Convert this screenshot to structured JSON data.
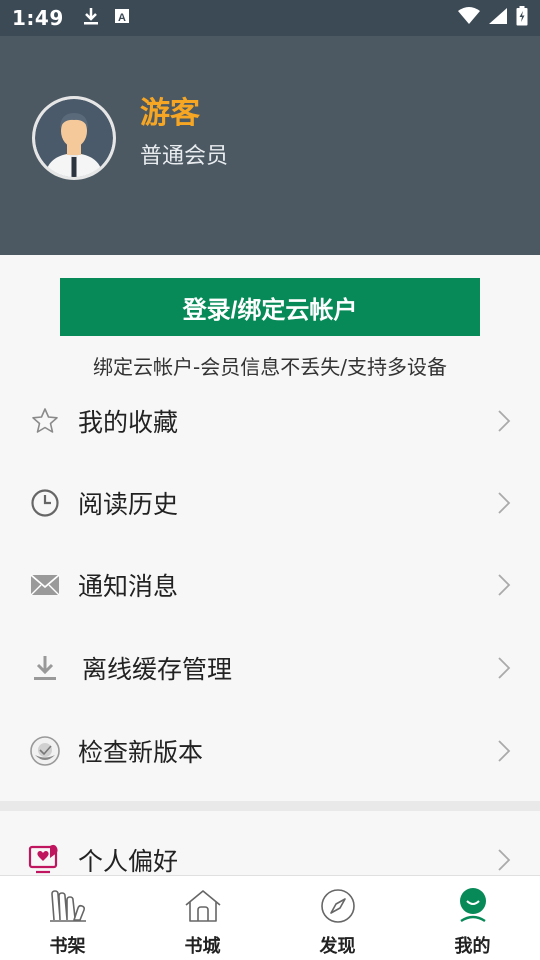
{
  "status_bar": {
    "time": "1:49",
    "icons": [
      "download-icon",
      "font-icon",
      "wifi-icon",
      "signal-icon",
      "battery-charging-icon"
    ]
  },
  "profile": {
    "name": "游客",
    "level": "普通会员",
    "avatar_icon": "user-avatar-icon",
    "name_color": "#f6a623"
  },
  "login": {
    "button_label": "登录/绑定云帐户",
    "hint": "绑定云帐户-会员信息不丢失/支持多设备",
    "button_color": "#078a58"
  },
  "menu": {
    "items": [
      {
        "label": "我的收藏",
        "icon": "star-icon"
      },
      {
        "label": "阅读历史",
        "icon": "clock-icon"
      },
      {
        "label": "通知消息",
        "icon": "mail-icon"
      },
      {
        "label": "离线缓存管理",
        "icon": "download-icon"
      },
      {
        "label": "检查新版本",
        "icon": "update-icon"
      }
    ],
    "items2": [
      {
        "label": "个人偏好",
        "icon": "preference-icon"
      }
    ]
  },
  "bottom_nav": {
    "items": [
      {
        "label": "书架",
        "icon": "bookshelf-icon"
      },
      {
        "label": "书城",
        "icon": "bookstore-icon"
      },
      {
        "label": "发现",
        "icon": "compass-icon"
      },
      {
        "label": "我的",
        "icon": "profile-icon",
        "active": true
      }
    ],
    "active_color": "#078a58"
  }
}
